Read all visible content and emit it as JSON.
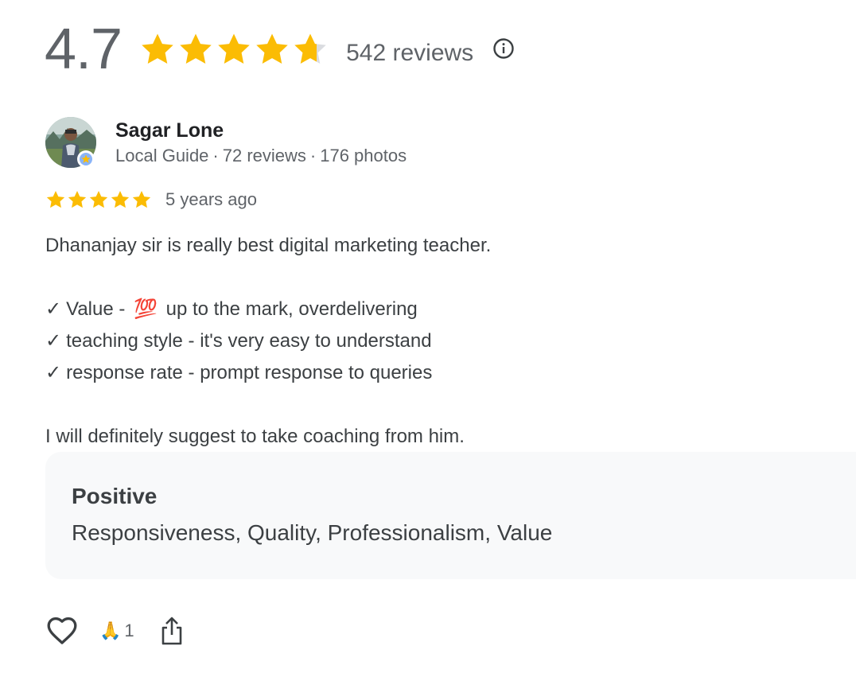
{
  "summary": {
    "rating": "4.7",
    "stars": 4.7,
    "review_count": "542 reviews"
  },
  "reviewer": {
    "name": "Sagar Lone",
    "role": "Local Guide",
    "reviews": "72 reviews",
    "photos": "176 photos",
    "separator": "·"
  },
  "review": {
    "stars": 5,
    "time": "5 years ago",
    "intro": "Dhananjay sir is really best digital marketing teacher.",
    "check_glyph": "✓",
    "points": [
      {
        "prefix": "Value - ",
        "emoji": "💯",
        "suffix": " up to the mark, overdelivering"
      },
      {
        "text": "teaching style - it's very easy to understand"
      },
      {
        "text": "response rate - prompt response to queries"
      }
    ],
    "closing": "I will definitely suggest to take coaching from him."
  },
  "attributes": {
    "title": "Positive",
    "values": "Responsiveness, Quality, Professionalism, Value"
  },
  "actions": {
    "reaction_emoji": "🙏",
    "reaction_count": "1"
  },
  "colors": {
    "star": "#fbbc04",
    "star_empty": "#dadce0",
    "text_secondary": "#5f6368"
  },
  "icons": {
    "info": "info-icon",
    "like": "heart-outline-icon",
    "share": "share-icon",
    "badge": "local-guide-badge-icon"
  }
}
